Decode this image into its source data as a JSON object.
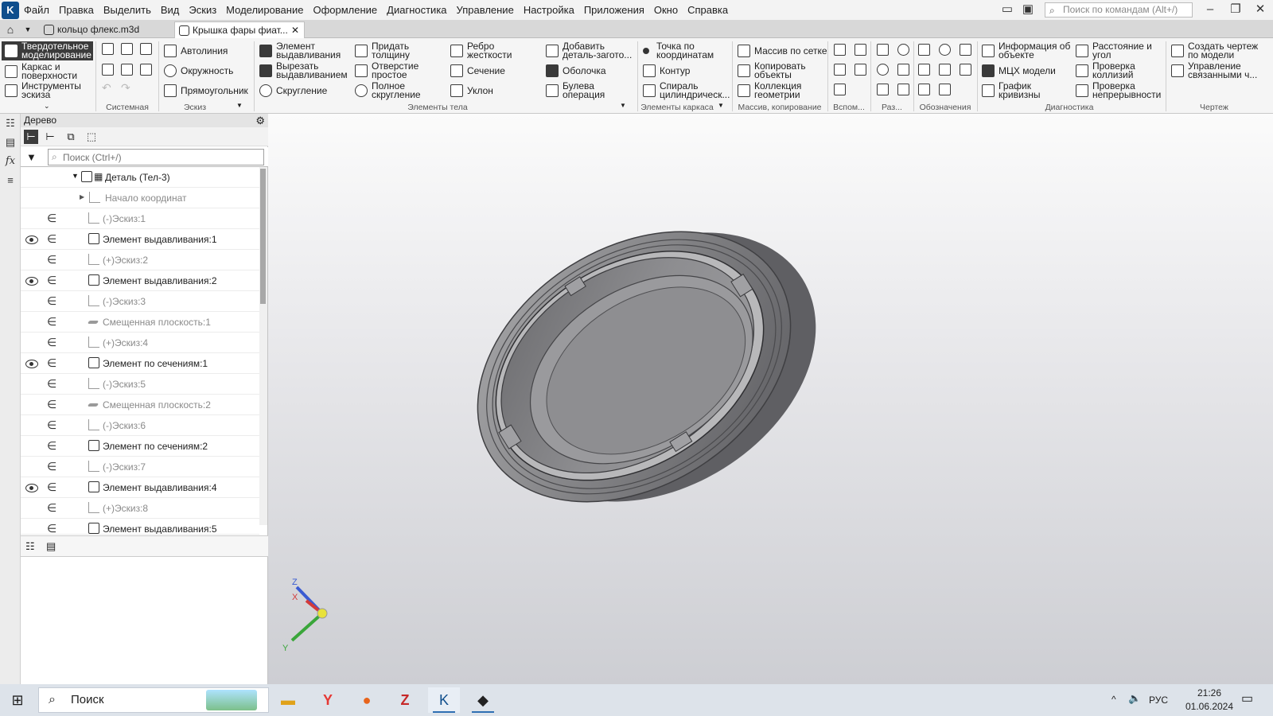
{
  "menubar": {
    "items": [
      "Файл",
      "Правка",
      "Выделить",
      "Вид",
      "Эскиз",
      "Моделирование",
      "Оформление",
      "Диагностика",
      "Управление",
      "Настройка",
      "Приложения",
      "Окно",
      "Справка"
    ],
    "search_placeholder": "Поиск по командам (Alt+/)"
  },
  "tabs": [
    {
      "label": "кольцо флекс.m3d",
      "active": false
    },
    {
      "label": "Крышка фары фиат...",
      "active": true,
      "close": "✕"
    }
  ],
  "ribbon": {
    "modes": [
      "Твердотельное моделирование",
      "Каркас и поверхности",
      "Инструменты эскиза"
    ],
    "groups": {
      "system": "Системная",
      "sketch": "Эскиз",
      "body": "Элементы тела",
      "frame": "Элементы каркаса",
      "array": "Массив, копирование",
      "aux": "Вспом...",
      "size": "Раз...",
      "notation": "Обозначения",
      "diag": "Диагностика",
      "drawing": "Чертеж"
    },
    "sketch_tools": [
      "Автолиния",
      "Окружность",
      "Прямоугольник"
    ],
    "body_tools": {
      "c1": [
        "Элемент выдавливания",
        "Вырезать выдавливанием",
        "Скругление"
      ],
      "c2": [
        "Придать толщину",
        "Отверстие простое",
        "Полное скругление"
      ],
      "c3": [
        "Ребро жесткости",
        "Сечение",
        "Уклон"
      ],
      "c4": [
        "Добавить деталь-загото...",
        "Оболочка",
        "Булева операция"
      ]
    },
    "frame_tools": [
      "Точка по координатам",
      "Контур",
      "Спираль цилиндрическ..."
    ],
    "array_tools": [
      "Массив по сетке",
      "Копировать объекты",
      "Коллекция геометрии"
    ],
    "diag_tools": [
      "Информация об объекте",
      "МЦХ модели",
      "График кривизны",
      "Расстояние и угол",
      "Проверка коллизий",
      "Проверка непрерывности"
    ],
    "drawing_tools": [
      "Создать чертеж по модели",
      "Управление связанными ч..."
    ]
  },
  "tree": {
    "title": "Дерево",
    "search_placeholder": "Поиск (Ctrl+/)",
    "root": "Деталь (Тел-3)",
    "nodes": [
      {
        "label": "Начало координат",
        "dim": true
      },
      {
        "label": "(-)Эскиз:1",
        "dim": true
      },
      {
        "label": "Элемент выдавливания:1",
        "visible": true
      },
      {
        "label": "(+)Эскиз:2",
        "dim": true
      },
      {
        "label": "Элемент выдавливания:2",
        "visible": true
      },
      {
        "label": "(-)Эскиз:3",
        "dim": true
      },
      {
        "label": "Смещенная плоскость:1",
        "dim": true
      },
      {
        "label": "(+)Эскиз:4",
        "dim": true
      },
      {
        "label": "Элемент по сечениям:1",
        "visible": true
      },
      {
        "label": "(-)Эскиз:5",
        "dim": true
      },
      {
        "label": "Смещенная плоскость:2",
        "dim": true
      },
      {
        "label": "(-)Эскиз:6",
        "dim": true
      },
      {
        "label": "Элемент по сечениям:2"
      },
      {
        "label": "(-)Эскиз:7",
        "dim": true
      },
      {
        "label": "Элемент выдавливания:4",
        "visible": true
      },
      {
        "label": "(+)Эскиз:8",
        "dim": true
      },
      {
        "label": "Элемент выдавливания:5"
      }
    ]
  },
  "axes": {
    "x": "X",
    "y": "Y",
    "z": "Z"
  },
  "taskbar": {
    "search_label": "Поиск",
    "lang": "РУС",
    "time": "21:26",
    "date": "01.06.2024"
  },
  "colors": {
    "active_mode": "#3b3b3b",
    "logo": "#0f4e8c",
    "axis_x": "#d23a3a",
    "axis_y": "#3aa63a",
    "axis_z": "#3a5bd2"
  }
}
